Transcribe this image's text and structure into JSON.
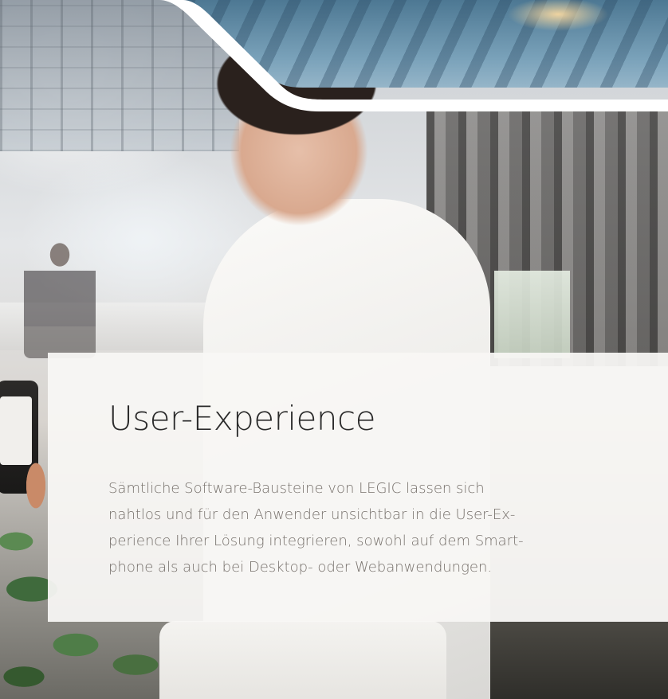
{
  "section": {
    "title": "User-Experience",
    "body_lines": [
      "Sämtliche Software-Bausteine von LEGIC lassen sich",
      "nahtlos und für den Anwender unsichtbar in die User-Ex-",
      "perience Ihrer Lösung integrieren, sowohl auf dem Smart-",
      "phone als auch bei Desktop- oder Webanwendungen."
    ]
  },
  "colors": {
    "title_text": "#2b2b2b",
    "body_text": "#77716c",
    "card_background": "#f8f6f4"
  }
}
